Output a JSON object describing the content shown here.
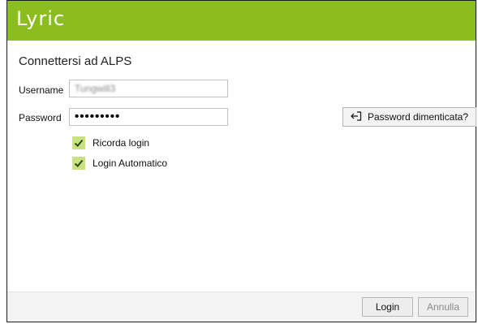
{
  "app": {
    "logo": "Lyric"
  },
  "dialog": {
    "title": "Connettersi ad ALPS",
    "username_label": "Username",
    "username_value": "Tungwill3",
    "password_label": "Password",
    "password_value": "•••••••••",
    "forgot_password_label": "Password dimenticata?",
    "remember_login_label": "Ricorda login",
    "remember_login_checked": true,
    "auto_login_label": "Login Automatico",
    "auto_login_checked": true
  },
  "footer": {
    "login_label": "Login",
    "cancel_label": "Annulla"
  },
  "colors": {
    "header": "#8cbd1f",
    "checkbox": "#c7e281",
    "check_mark": "#2f4a10"
  },
  "icons": {
    "forgot_password": "sign-in-arrow-icon",
    "checkbox": "check-icon"
  }
}
